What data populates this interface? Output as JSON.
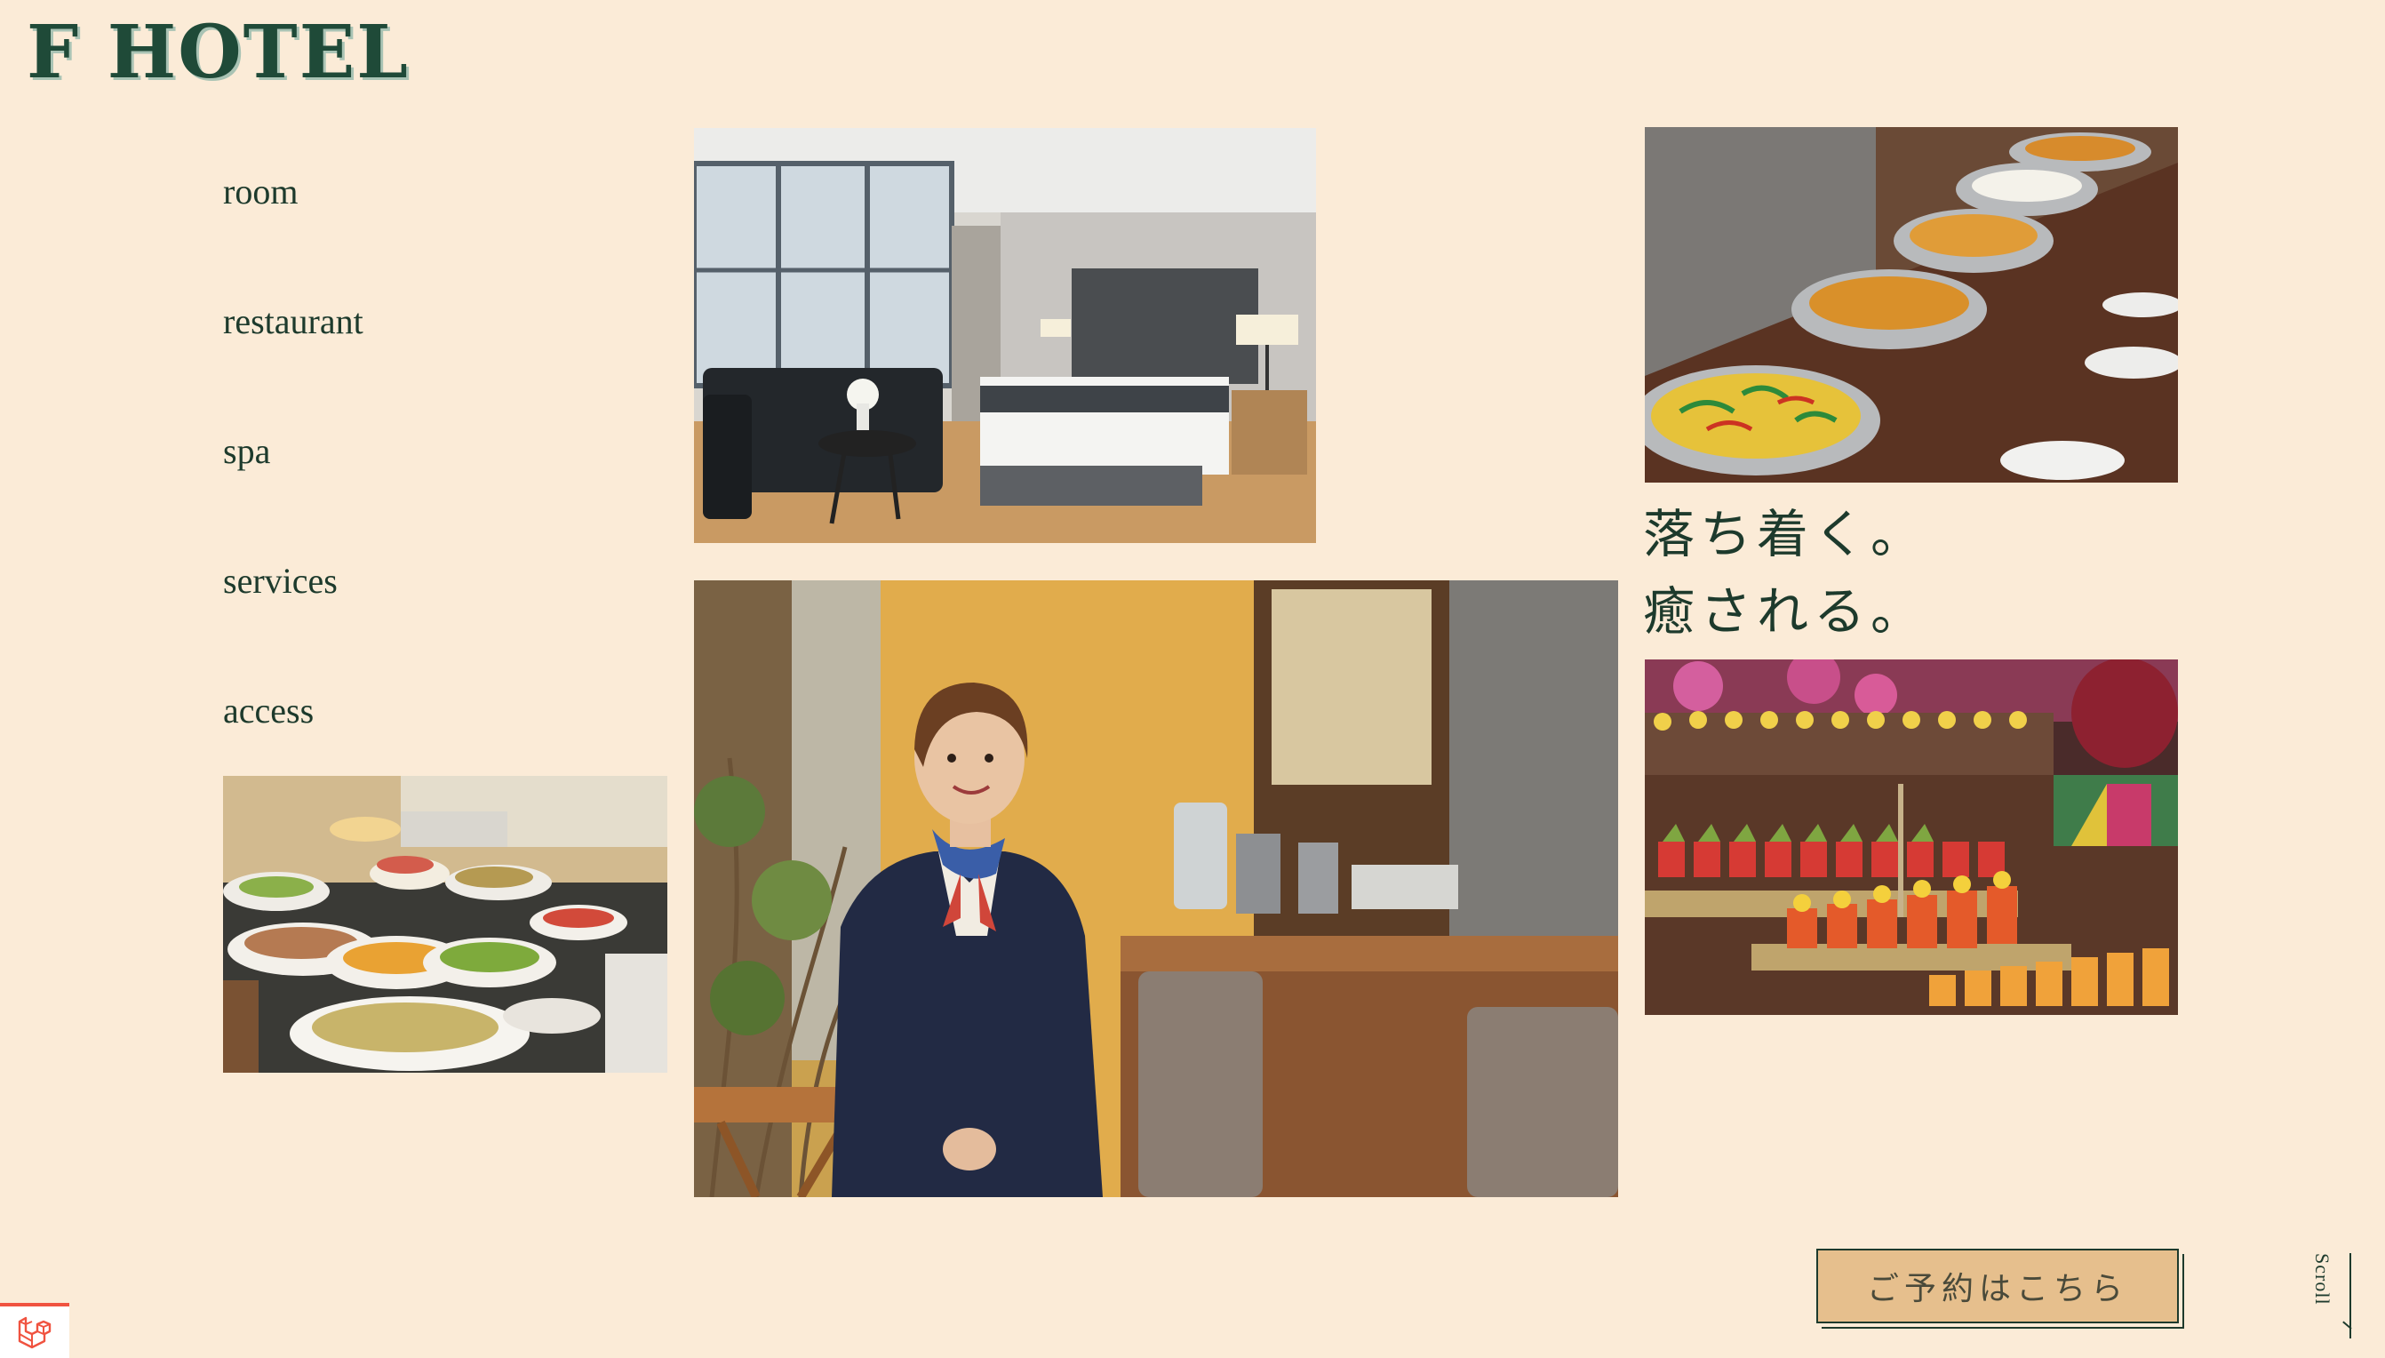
{
  "header": {
    "logo_text": "F HOTEL"
  },
  "nav": {
    "items": [
      {
        "label": "room"
      },
      {
        "label": "restaurant"
      },
      {
        "label": "spa"
      },
      {
        "label": "services"
      },
      {
        "label": "access"
      }
    ]
  },
  "tagline": {
    "line1": "落ち着く。",
    "line2": "癒される。"
  },
  "reserve": {
    "label": "ご予約はこちら"
  },
  "scroll": {
    "label": "Scroll"
  },
  "images": [
    {
      "name": "hotel-room-photo",
      "icon": "photo"
    },
    {
      "name": "hot-buffet-photo",
      "icon": "photo"
    },
    {
      "name": "hotel-staff-photo",
      "icon": "photo"
    },
    {
      "name": "salad-buffet-photo",
      "icon": "photo"
    },
    {
      "name": "dessert-buffet-photo",
      "icon": "photo"
    }
  ],
  "debug": {
    "icon": "laravel-logo-icon"
  },
  "colors": {
    "background": "#fbebd7",
    "text": "#1d3a2c",
    "button": "#e6bf8d",
    "debug_accent": "#f05340"
  }
}
